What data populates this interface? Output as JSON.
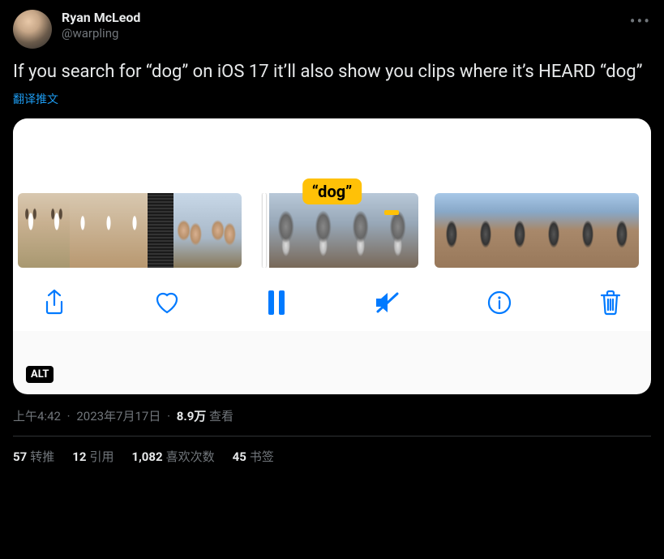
{
  "author": {
    "display_name": "Ryan McLeod",
    "handle": "@warpling"
  },
  "tweet_text": "If you search for “dog” on iOS 17 it’ll also show you clips where it’s HEARD “dog”",
  "translate_label": "翻译推文",
  "media": {
    "search_chip": "“dog”",
    "alt_badge": "ALT",
    "toolbar_icons": {
      "share": "share-icon",
      "like": "heart-icon",
      "pause": "pause-icon",
      "mute": "mute-icon",
      "info": "info-icon",
      "trash": "trash-icon"
    }
  },
  "meta": {
    "time": "上午4:42",
    "date": "2023年7月17日",
    "views_value": "8.9万",
    "views_label": "查看"
  },
  "stats": {
    "retweets": {
      "value": "57",
      "label": "转推"
    },
    "quotes": {
      "value": "12",
      "label": "引用"
    },
    "likes": {
      "value": "1,082",
      "label": "喜欢次数"
    },
    "bookmarks": {
      "value": "45",
      "label": "书签"
    }
  }
}
